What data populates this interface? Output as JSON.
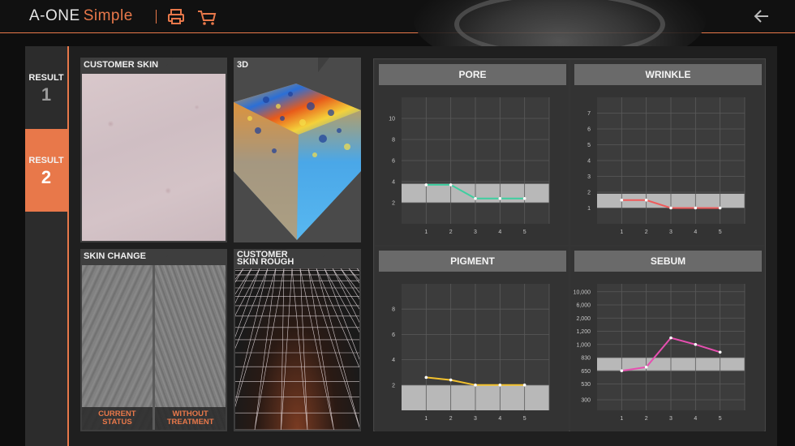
{
  "header": {
    "brand": "A-ONE",
    "brand_sub": "Simple"
  },
  "icons": {
    "print": "printer-icon",
    "cart": "cart-icon",
    "back": "back-arrow-icon"
  },
  "tabs": [
    {
      "label": "RESULT",
      "number": "1"
    },
    {
      "label": "RESULT",
      "number": "2"
    }
  ],
  "panels": {
    "customer_skin": "CUSTOMER SKIN",
    "three_d": "3D",
    "skin_change": "SKIN CHANGE",
    "skin_change_left": "CURRENT\nSTATUS",
    "skin_change_right": "WITHOUT\nTREATMENT",
    "rough_line1": "CUSTOMER",
    "rough_line2": "SKIN ROUGH"
  },
  "colors": {
    "accent": "#e8784a",
    "pore": "#3ecfa0",
    "wrinkle": "#ef5b5b",
    "pigment": "#f2c12e",
    "sebum": "#e64fb0"
  },
  "chart_data": [
    {
      "type": "line",
      "title": "PORE",
      "x": [
        1,
        2,
        3,
        4,
        5
      ],
      "values": [
        3.7,
        3.7,
        2.4,
        2.4,
        2.4
      ],
      "yticks": [
        "2",
        "4",
        "6",
        "8",
        "10"
      ],
      "ylim": [
        0,
        12
      ],
      "band": [
        2,
        3.8
      ],
      "color": "#3ecfa0"
    },
    {
      "type": "line",
      "title": "WRINKLE",
      "x": [
        1,
        2,
        3,
        4,
        5
      ],
      "values": [
        1.5,
        1.5,
        1.0,
        1.0,
        1.0
      ],
      "yticks": [
        "1",
        "2",
        "3",
        "4",
        "5",
        "6",
        "7"
      ],
      "ylim": [
        0,
        8
      ],
      "band": [
        1,
        1.9
      ],
      "color": "#ef5b5b"
    },
    {
      "type": "line",
      "title": "PIGMENT",
      "x": [
        1,
        2,
        3,
        4,
        5
      ],
      "values": [
        2.6,
        2.4,
        2.0,
        2.0,
        2.0
      ],
      "yticks": [
        "2",
        "4",
        "6",
        "8"
      ],
      "ylim": [
        0,
        10
      ],
      "band": [
        0,
        2
      ],
      "color": "#f2c12e"
    },
    {
      "type": "line",
      "title": "SEBUM",
      "x": [
        1,
        2,
        3,
        4,
        5
      ],
      "values": [
        650,
        700,
        1100,
        1000,
        900
      ],
      "yticks": [
        "300",
        "530",
        "650",
        "830",
        "1,000",
        "1,200",
        "2,000",
        "6,000",
        "10,000"
      ],
      "ylim": [
        0,
        10
      ],
      "band": [
        650,
        830
      ],
      "color": "#e64fb0"
    }
  ]
}
